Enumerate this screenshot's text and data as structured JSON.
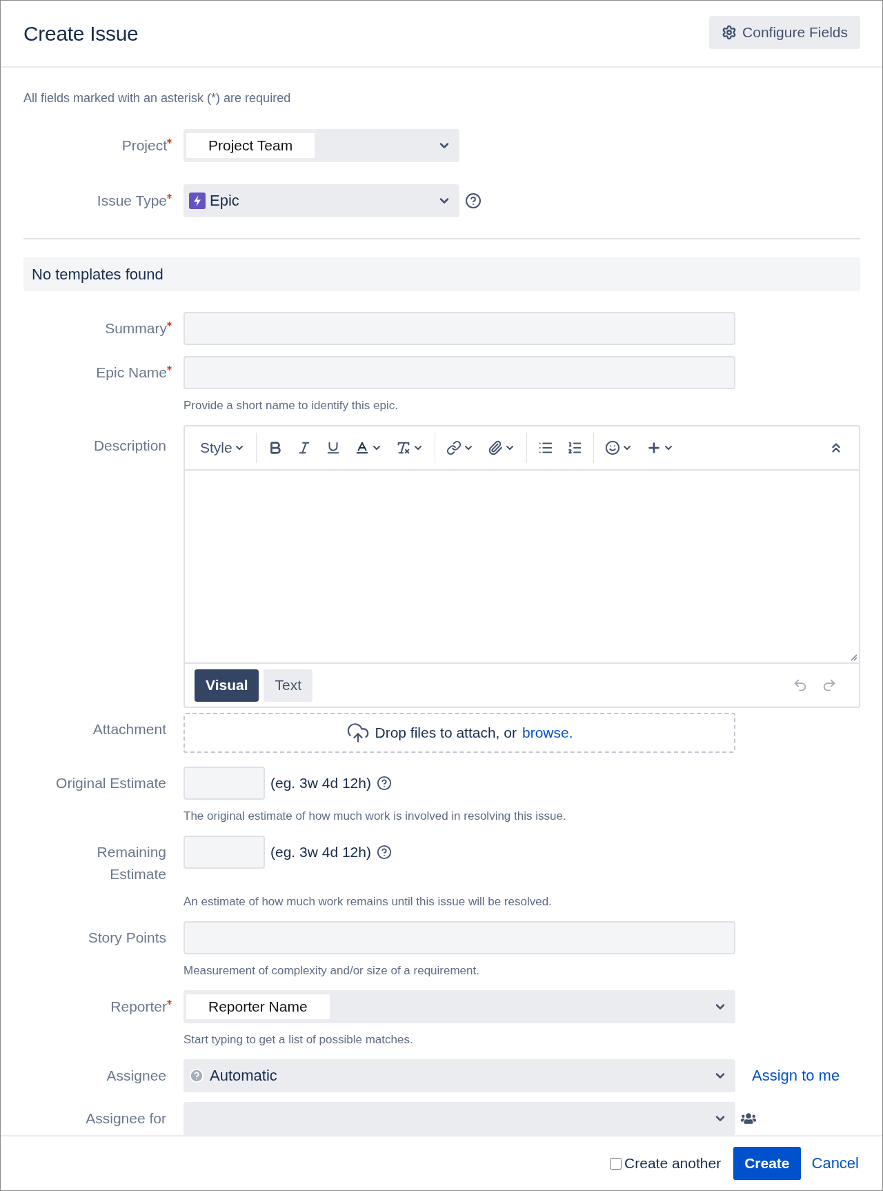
{
  "dialog": {
    "title": "Create Issue",
    "configure_button": "Configure Fields"
  },
  "required_note": "All fields marked with an asterisk (*) are required",
  "top_fields": [
    {
      "label": "Project",
      "required": true,
      "kind": "select",
      "value": "Project Team"
    },
    {
      "label": "Issue Type",
      "required": true,
      "kind": "issue-type",
      "value": "Epic"
    }
  ],
  "template_banner": "No templates found",
  "fields": [
    {
      "label": "Summary",
      "required": true,
      "kind": "text"
    },
    {
      "label": "Epic Name",
      "required": true,
      "kind": "text",
      "hint": "Provide a short name to identify this epic."
    },
    {
      "label": "Description",
      "required": false,
      "kind": "editor",
      "style_label": "Style",
      "modes": [
        {
          "label": "Visual",
          "selected": true
        },
        {
          "label": "Text",
          "selected": false
        }
      ]
    },
    {
      "label": "Attachment",
      "required": false,
      "kind": "attachment",
      "text": "Drop files to attach, or",
      "link": "browse."
    },
    {
      "label": "Original Estimate",
      "required": false,
      "kind": "estimate",
      "format": "(eg. 3w 4d 12h)",
      "hint": "The original estimate of how much work is involved in resolving this issue."
    },
    {
      "label": "Remaining\nEstimate",
      "required": false,
      "kind": "estimate",
      "format": "(eg. 3w 4d 12h)",
      "hint": "An estimate of how much work remains until this issue will be resolved."
    },
    {
      "label": "Story Points",
      "required": false,
      "kind": "text",
      "hint": "Measurement of complexity and/or size of a requirement."
    },
    {
      "label": "Reporter",
      "required": true,
      "kind": "user",
      "value": "Reporter Name",
      "hint": "Start typing to get a list of possible matches."
    },
    {
      "label": "Assignee",
      "required": false,
      "kind": "assignee",
      "value": "Automatic",
      "link": "Assign to me"
    },
    {
      "label": "Assignee for",
      "required": false,
      "kind": "group"
    }
  ],
  "footer": {
    "create_another": {
      "label": "Create another",
      "checked": false
    },
    "create_button": "Create",
    "cancel_link": "Cancel"
  }
}
